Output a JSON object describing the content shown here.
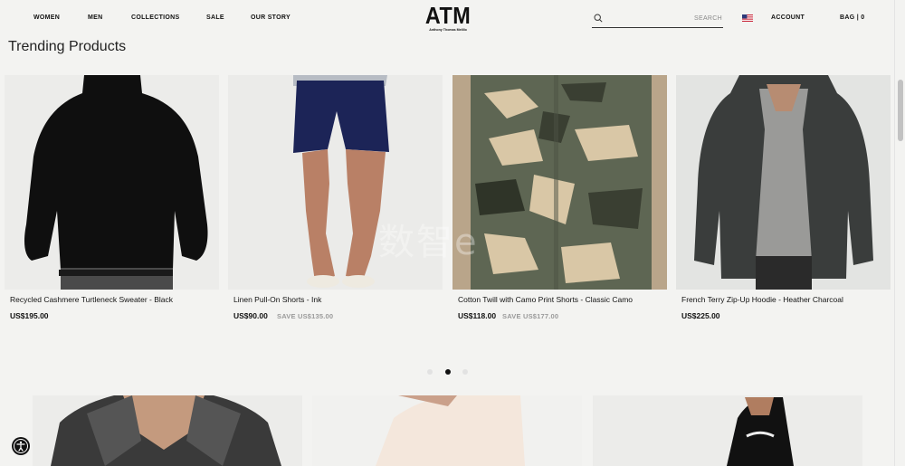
{
  "nav": {
    "items": [
      {
        "label": "WOMEN"
      },
      {
        "label": "MEN"
      },
      {
        "label": "COLLECTIONS"
      },
      {
        "label": "SALE"
      },
      {
        "label": "OUR STORY"
      }
    ]
  },
  "logo": {
    "main": "ATM",
    "sub": "Anthony Thomas Melillo"
  },
  "search": {
    "placeholder": "SEARCH",
    "icon": "search-icon"
  },
  "locale": {
    "icon": "us-flag-icon"
  },
  "account": {
    "label": "ACCOUNT"
  },
  "bag": {
    "label": "BAG | 0"
  },
  "section": {
    "title": "Trending Products"
  },
  "products": [
    {
      "name": "Recycled Cashmere Turtleneck Sweater - Black",
      "price": "US$195.00",
      "save": ""
    },
    {
      "name": "Linen Pull-On Shorts - Ink",
      "price": "US$90.00",
      "save": "SAVE US$135.00"
    },
    {
      "name": "Cotton Twill with Camo Print Shorts - Classic Camo",
      "price": "US$118.00",
      "save": "SAVE US$177.00"
    },
    {
      "name": "French Terry Zip-Up Hoodie - Heather Charcoal",
      "price": "US$225.00",
      "save": ""
    }
  ],
  "carousel": {
    "pages": 3,
    "active_page": 2
  },
  "watermark": {
    "text": "数智e"
  },
  "colors": {
    "background": "#f3f3f1",
    "text": "#111111",
    "muted": "#9a9a9a",
    "active_dot": "#111111"
  }
}
